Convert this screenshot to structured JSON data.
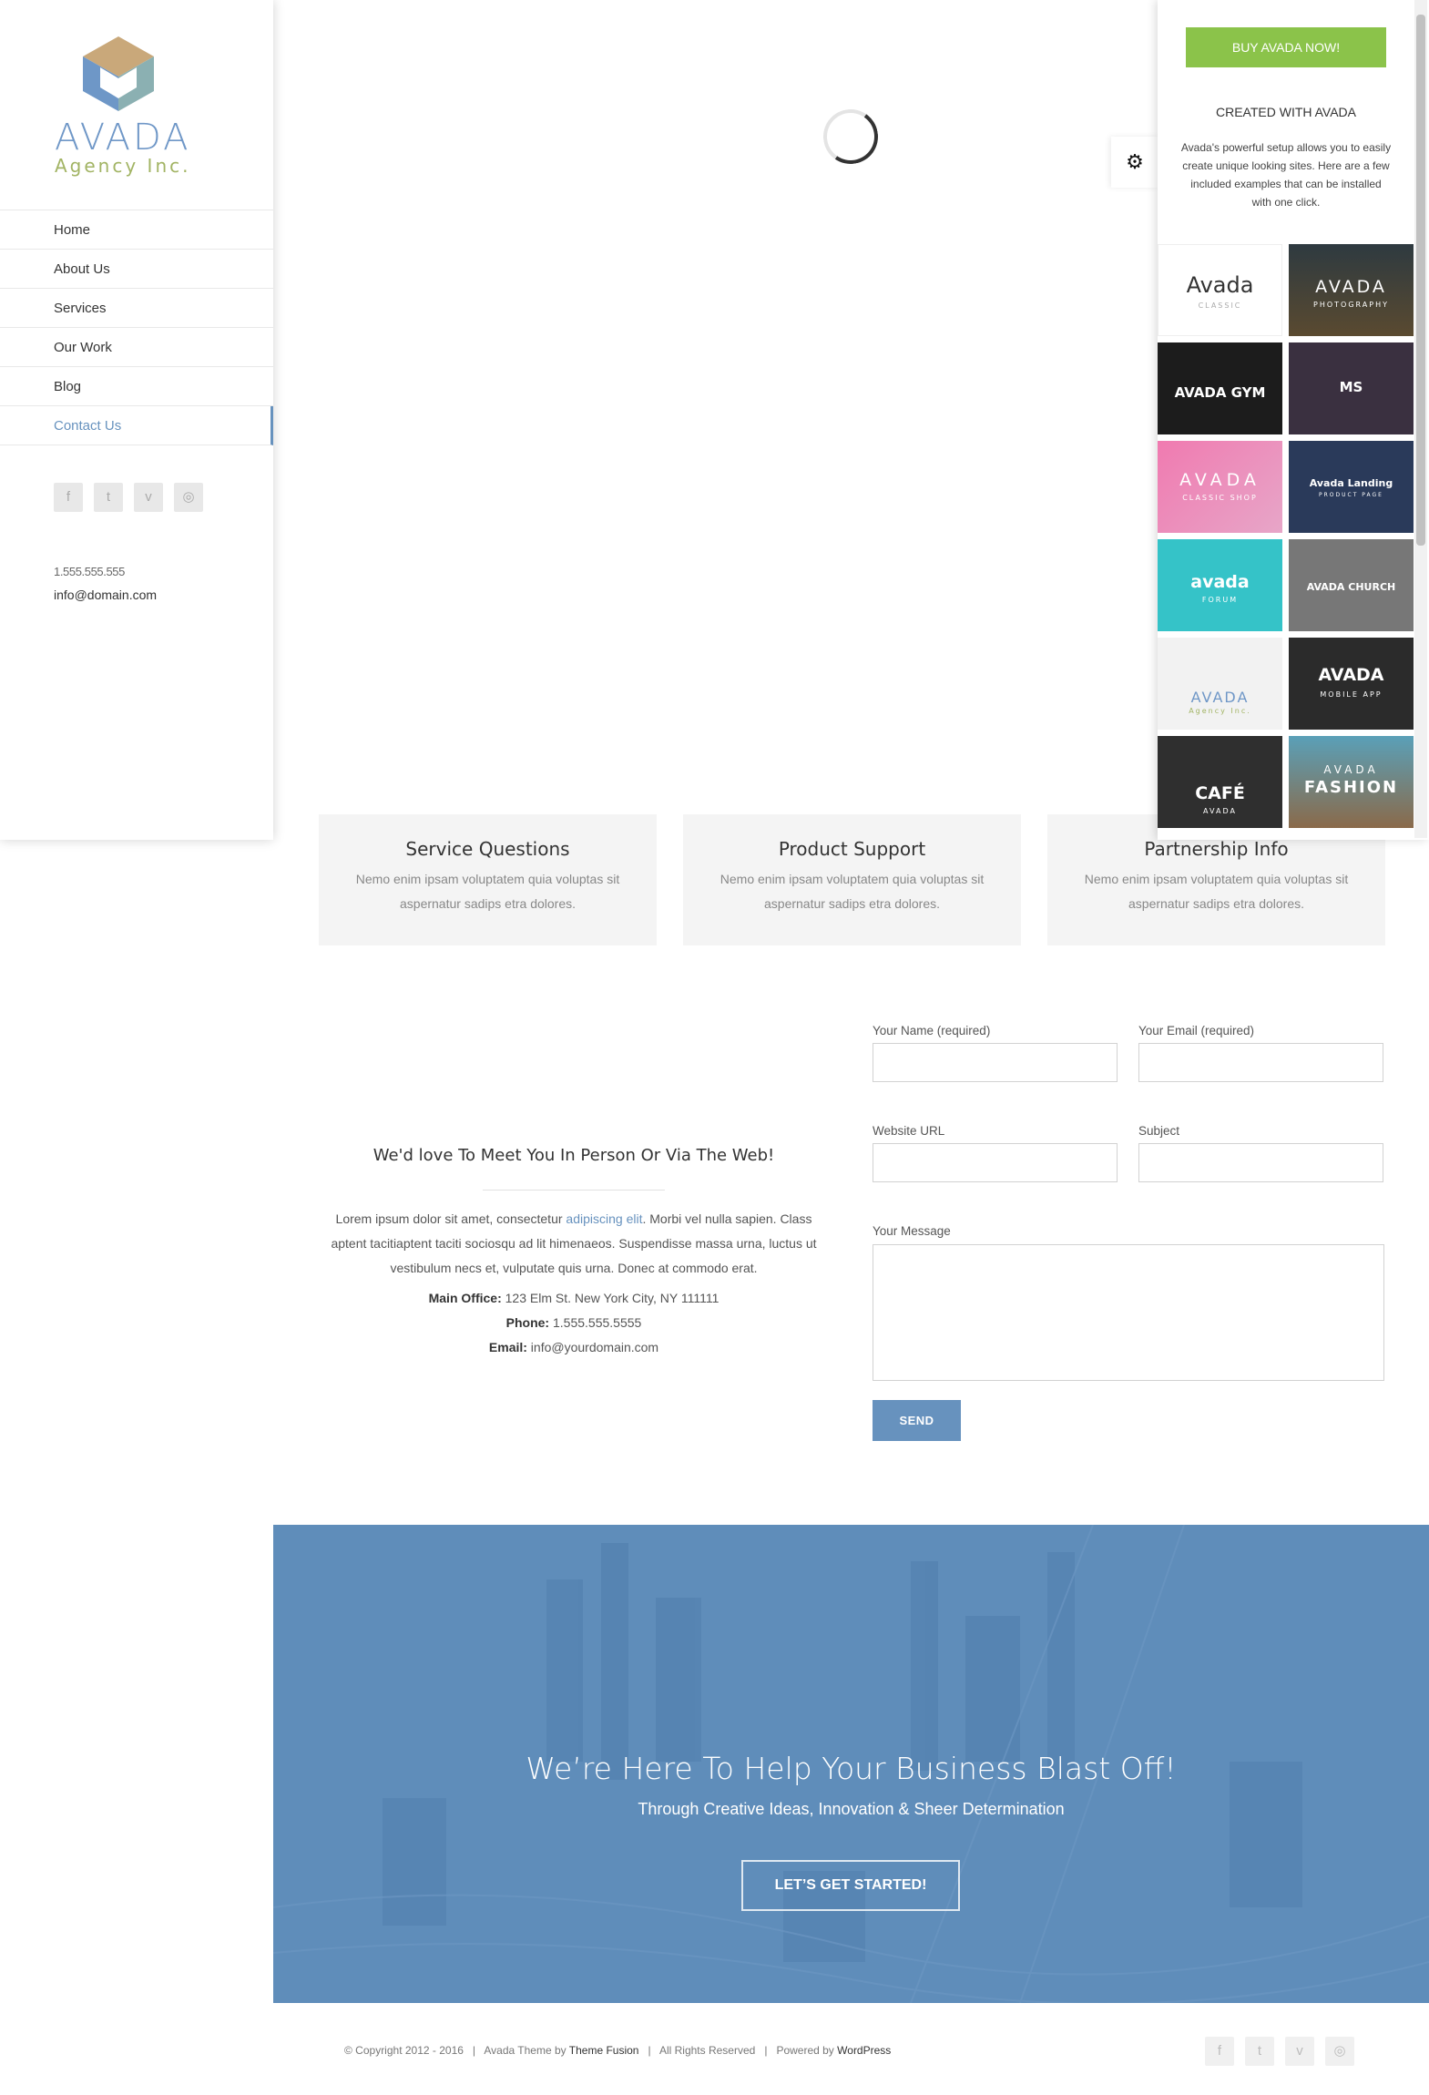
{
  "logo": {
    "word": "AVADA",
    "sub": "Agency Inc."
  },
  "nav": [
    {
      "label": "Home"
    },
    {
      "label": "About Us"
    },
    {
      "label": "Services"
    },
    {
      "label": "Our Work"
    },
    {
      "label": "Blog"
    },
    {
      "label": "Contact Us"
    }
  ],
  "sidebar_contact": {
    "phone": "1.555.555.555",
    "email": "info@domain.com"
  },
  "services": [
    {
      "title": "Service Questions",
      "text": "Nemo enim ipsam voluptatem quia voluptas sit aspernatur sadips etra dolores."
    },
    {
      "title": "Product Support",
      "text": "Nemo enim ipsam voluptatem quia voluptas sit aspernatur sadips etra dolores."
    },
    {
      "title": "Partnership Info",
      "text": "Nemo enim ipsam voluptatem quia voluptas sit aspernatur sadips etra dolores."
    }
  ],
  "info": {
    "heading": "We'd love To Meet You In Person Or Via The Web!",
    "lorem_before": "Lorem ipsum dolor sit amet, consectetur ",
    "lorem_link": "adipiscing elit",
    "lorem_after": ". Morbi vel nulla sapien. Class aptent tacitiaptent taciti sociosqu ad lit himenaeos. Suspendisse massa urna, luctus ut vestibulum necs et, vulputate quis urna. Donec at commodo erat.",
    "office_label": "Main Office:",
    "office_value": " 123 Elm St. New York City, NY 111111",
    "phone_label": "Phone:",
    "phone_value": " 1.555.555.5555",
    "email_label": "Email:",
    "email_value": " info@yourdomain.com"
  },
  "form": {
    "name_label": "Your Name (required)",
    "email_label": "Your Email (required)",
    "url_label": "Website URL",
    "subject_label": "Subject",
    "message_label": "Your Message",
    "send_label": "SEND"
  },
  "hero": {
    "title": "We’re Here To Help Your Business Blast Off!",
    "subtitle": "Through Creative Ideas, Innovation & Sheer Determination",
    "button": "LET’S GET STARTED!"
  },
  "footer": {
    "copy": "© Copyright 2012 - 2016   |   Avada Theme by ",
    "theme_fusion": "Theme Fusion",
    "rights": "   |   All Rights Reserved   |   Powered by ",
    "wordpress": "WordPress"
  },
  "social_icons": [
    "facebook-icon",
    "twitter-icon",
    "vimeo-icon",
    "instagram-icon"
  ],
  "panel": {
    "buy_label": "BUY AVADA NOW!",
    "created": "CREATED WITH AVADA",
    "description": "Avada's powerful setup allows you to easily create unique looking sites. Here are a few included examples that can be installed with one click.",
    "thumbs": [
      {
        "title": "Avada",
        "sub": "CLASSIC"
      },
      {
        "title": "AVADA",
        "sub": "PHOTOGRAPHY"
      },
      {
        "title": "AVADA GYM",
        "sub": ""
      },
      {
        "title": "MS",
        "sub": ""
      },
      {
        "title": "AVADA",
        "sub": "CLASSIC SHOP"
      },
      {
        "title": "Avada Landing",
        "sub": "PRODUCT PAGE"
      },
      {
        "title": "avada",
        "sub": "FORUM"
      },
      {
        "title": "AVADA CHURCH",
        "sub": ""
      },
      {
        "title": "AVADA",
        "sub": "Agency Inc."
      },
      {
        "title": "AVADA",
        "sub": "MOBILE APP"
      },
      {
        "title": "CAFÉ",
        "sub": "AVADA"
      },
      {
        "title": "AVADA",
        "sub": "FASHION"
      }
    ]
  },
  "colors": {
    "accent": "#6792be",
    "buy": "#8bc34a",
    "hero": "#5f8dba",
    "logo_blue": "#6f97c7",
    "logo_green": "#a2b464"
  }
}
